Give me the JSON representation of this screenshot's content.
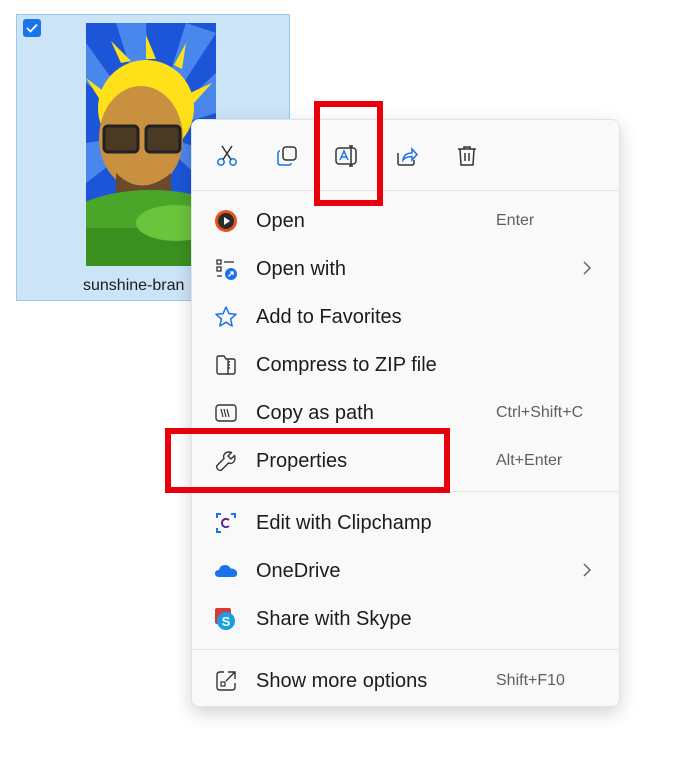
{
  "file": {
    "name": "sunshine-bran",
    "selected": true
  },
  "toolbar": {
    "buttons": [
      {
        "name": "Cut",
        "icon": "scissors-icon"
      },
      {
        "name": "Copy",
        "icon": "copy-icon"
      },
      {
        "name": "Rename",
        "icon": "rename-icon"
      },
      {
        "name": "Share",
        "icon": "share-icon"
      },
      {
        "name": "Delete",
        "icon": "trash-icon"
      }
    ]
  },
  "menu": {
    "items": [
      {
        "label": "Open",
        "accel": "Enter",
        "icon": "media-player-icon"
      },
      {
        "label": "Open with",
        "accel": "",
        "icon": "open-with-icon",
        "submenu": true
      },
      {
        "label": "Add to Favorites",
        "accel": "",
        "icon": "star-icon"
      },
      {
        "label": "Compress to ZIP file",
        "accel": "",
        "icon": "zip-icon"
      },
      {
        "label": "Copy as path",
        "accel": "Ctrl+Shift+C",
        "icon": "path-icon"
      },
      {
        "label": "Properties",
        "accel": "Alt+Enter",
        "icon": "wrench-icon"
      },
      {
        "label": "Edit with Clipchamp",
        "accel": "",
        "icon": "clipchamp-icon"
      },
      {
        "label": "OneDrive",
        "accel": "",
        "icon": "onedrive-icon",
        "submenu": true
      },
      {
        "label": "Share with Skype",
        "accel": "",
        "icon": "skype-icon"
      },
      {
        "label": "Show more options",
        "accel": "Shift+F10",
        "icon": "more-options-icon"
      }
    ]
  },
  "colors": {
    "highlight": "#e8000b",
    "selection": "#cce4f7",
    "accent": "#1a73e8"
  }
}
